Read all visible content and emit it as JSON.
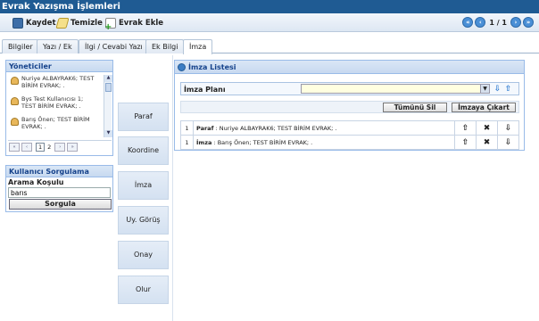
{
  "window_title": "Evrak Yazışma İşlemleri",
  "toolbar": {
    "save_label": "Kaydet",
    "clear_label": "Temizle",
    "add_doc_label": "Evrak Ekle",
    "pager_text": "1 / 1"
  },
  "tabs": [
    {
      "label": "Bilgiler"
    },
    {
      "label": "Yazı / Ek"
    },
    {
      "label": "İlgi / Cevabi Yazı"
    },
    {
      "label": "Ek Bilgi"
    },
    {
      "label": "İmza"
    }
  ],
  "managers": {
    "title": "Yöneticiler",
    "items": [
      {
        "line1": "Nuriye ALBAYRAK6; TEST",
        "line2": "BİRİM EVRAK; ."
      },
      {
        "line1": "Bys Test Kullanıcısı 1;",
        "line2": "TEST BİRİM EVRAK; ."
      },
      {
        "line1": "Barış Önen; TEST BİRİM",
        "line2": "EVRAK; ."
      }
    ],
    "pager": {
      "current": "1",
      "next": "2"
    }
  },
  "query": {
    "title": "Kullanıcı Sorgulama",
    "label": "Arama Koşulu",
    "value": "barıs",
    "button": "Sorgula"
  },
  "actions": [
    {
      "label": "Paraf"
    },
    {
      "label": "Koordine"
    },
    {
      "label": "İmza"
    },
    {
      "label": "Uy. Görüş"
    },
    {
      "label": "Onay"
    },
    {
      "label": "Olur"
    }
  ],
  "signature": {
    "title": "İmza Listesi",
    "plan_label": "İmza Planı",
    "plan_value": "",
    "delete_all": "Tümünü Sil",
    "remove_from_signature": "İmzaya Çıkart",
    "rows": [
      {
        "num": "1",
        "role": "Paraf",
        "text": " : Nuriye ALBAYRAK6; TEST BİRİM EVRAK; ."
      },
      {
        "num": "1",
        "role": "İmza",
        "text": " : Barış Önen; TEST BİRİM EVRAK; ."
      }
    ]
  },
  "icons": [
    "save-icon",
    "clear-icon",
    "add-document-icon",
    "first-page-icon",
    "prev-page-icon",
    "next-page-icon",
    "last-page-icon",
    "user-icon",
    "info-icon",
    "arrow-up-icon",
    "arrow-down-icon",
    "delete-icon"
  ]
}
